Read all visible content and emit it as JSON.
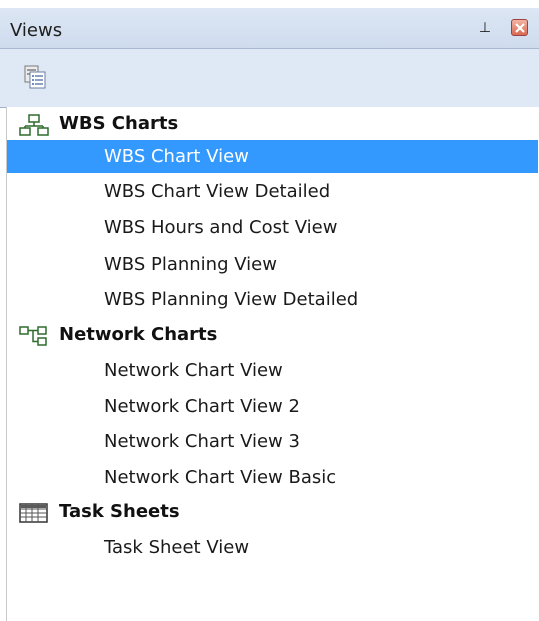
{
  "window": {
    "title": "Views",
    "pin_glyph": "⊥",
    "close_icon": "close-icon"
  },
  "colors": {
    "title_bg": "#dce6f4",
    "toolbar_bg": "#dfe8f5",
    "selection": "#3399ff"
  },
  "toolbar": {
    "icon": "view-list-icon"
  },
  "groups": [
    {
      "label": "WBS Charts",
      "icon": "wbs-chart-icon",
      "items": [
        "WBS Chart View",
        "WBS Chart View Detailed",
        "WBS Hours and Cost View",
        "WBS Planning View",
        "WBS Planning View Detailed"
      ]
    },
    {
      "label": "Network Charts",
      "icon": "network-chart-icon",
      "items": [
        "Network Chart View",
        "Network Chart View 2",
        "Network Chart View 3",
        "Network Chart View Basic"
      ]
    },
    {
      "label": "Task Sheets",
      "icon": "task-sheet-icon",
      "items": [
        "Task Sheet View"
      ]
    }
  ],
  "selected_item": "WBS Chart View"
}
